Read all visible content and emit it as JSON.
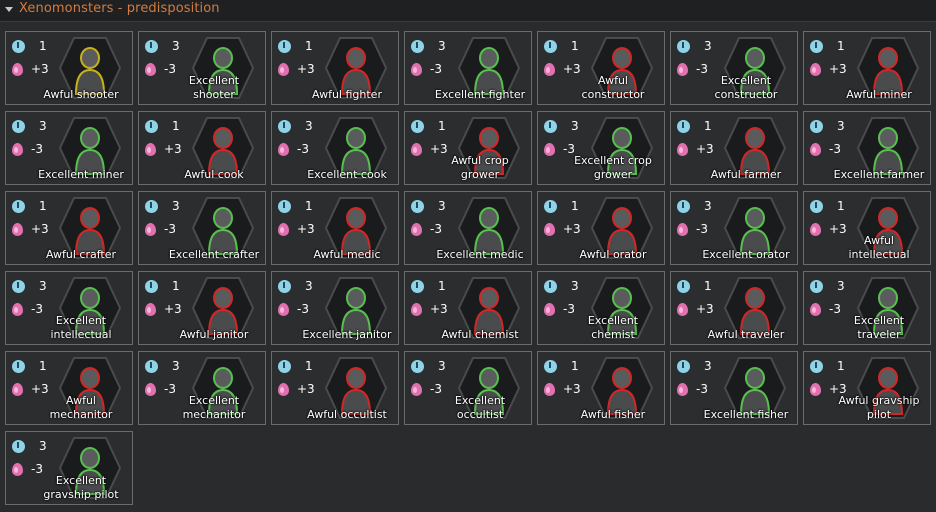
{
  "title": "Xenomonsters - predisposition",
  "cards": [
    {
      "t": "1",
      "m": "+3",
      "label": "Awful shooter",
      "glow": "#c7b21a"
    },
    {
      "t": "3",
      "m": "-3",
      "label": "Excellent shooter",
      "glow": "#58c04f"
    },
    {
      "t": "1",
      "m": "+3",
      "label": "Awful fighter",
      "glow": "#d02828"
    },
    {
      "t": "3",
      "m": "-3",
      "label": "Excellent fighter",
      "glow": "#58c04f"
    },
    {
      "t": "1",
      "m": "+3",
      "label": "Awful constructor",
      "glow": "#d02828"
    },
    {
      "t": "3",
      "m": "-3",
      "label": "Excellent constructor",
      "glow": "#58c04f"
    },
    {
      "t": "1",
      "m": "+3",
      "label": "Awful miner",
      "glow": "#d02828"
    },
    {
      "t": "3",
      "m": "-3",
      "label": "Excellent miner",
      "glow": "#58c04f"
    },
    {
      "t": "1",
      "m": "+3",
      "label": "Awful cook",
      "glow": "#d02828"
    },
    {
      "t": "3",
      "m": "-3",
      "label": "Excellent cook",
      "glow": "#58c04f"
    },
    {
      "t": "1",
      "m": "+3",
      "label": "Awful crop grower",
      "glow": "#d02828"
    },
    {
      "t": "3",
      "m": "-3",
      "label": "Excellent crop grower",
      "glow": "#58c04f"
    },
    {
      "t": "1",
      "m": "+3",
      "label": "Awful farmer",
      "glow": "#d02828"
    },
    {
      "t": "3",
      "m": "-3",
      "label": "Excellent farmer",
      "glow": "#58c04f"
    },
    {
      "t": "1",
      "m": "+3",
      "label": "Awful crafter",
      "glow": "#d02828"
    },
    {
      "t": "3",
      "m": "-3",
      "label": "Excellent crafter",
      "glow": "#58c04f"
    },
    {
      "t": "1",
      "m": "+3",
      "label": "Awful medic",
      "glow": "#d02828"
    },
    {
      "t": "3",
      "m": "-3",
      "label": "Excellent medic",
      "glow": "#58c04f"
    },
    {
      "t": "1",
      "m": "+3",
      "label": "Awful orator",
      "glow": "#d02828"
    },
    {
      "t": "3",
      "m": "-3",
      "label": "Excellent orator",
      "glow": "#58c04f"
    },
    {
      "t": "1",
      "m": "+3",
      "label": "Awful intellectual",
      "glow": "#d02828"
    },
    {
      "t": "3",
      "m": "-3",
      "label": "Excellent intellectual",
      "glow": "#58c04f"
    },
    {
      "t": "1",
      "m": "+3",
      "label": "Awful janitor",
      "glow": "#d02828"
    },
    {
      "t": "3",
      "m": "-3",
      "label": "Excellent janitor",
      "glow": "#58c04f"
    },
    {
      "t": "1",
      "m": "+3",
      "label": "Awful chemist",
      "glow": "#d02828"
    },
    {
      "t": "3",
      "m": "-3",
      "label": "Excellent chemist",
      "glow": "#58c04f"
    },
    {
      "t": "1",
      "m": "+3",
      "label": "Awful traveler",
      "glow": "#d02828"
    },
    {
      "t": "3",
      "m": "-3",
      "label": "Excellent traveler",
      "glow": "#58c04f"
    },
    {
      "t": "1",
      "m": "+3",
      "label": "Awful mechanitor",
      "glow": "#d02828"
    },
    {
      "t": "3",
      "m": "-3",
      "label": "Excellent mechanitor",
      "glow": "#58c04f"
    },
    {
      "t": "1",
      "m": "+3",
      "label": "Awful occultist",
      "glow": "#d02828"
    },
    {
      "t": "3",
      "m": "-3",
      "label": "Excellent occultist",
      "glow": "#58c04f"
    },
    {
      "t": "1",
      "m": "+3",
      "label": "Awful fisher",
      "glow": "#d02828"
    },
    {
      "t": "3",
      "m": "-3",
      "label": "Excellent fisher",
      "glow": "#58c04f"
    },
    {
      "t": "1",
      "m": "+3",
      "label": "Awful gravship pilot",
      "glow": "#d02828"
    },
    {
      "t": "3",
      "m": "-3",
      "label": "Excellent gravship pilot",
      "glow": "#58c04f"
    }
  ]
}
